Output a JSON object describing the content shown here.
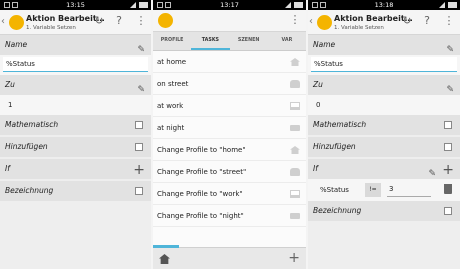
{
  "left": {
    "status_time": "13:15",
    "title": "Aktion Bearbeit…",
    "subtitle": "1. Variable Setzen",
    "name_label": "Name",
    "name_value": "%Status",
    "zu_label": "Zu",
    "zu_value": "1",
    "math_label": "Mathematisch",
    "add_label": "Hinzufügen",
    "if_label": "If",
    "bez_label": "Bezeichnung"
  },
  "middle": {
    "status_time": "13:17",
    "tabs": [
      "PROFILE",
      "TASKS",
      "SZENEN",
      "VAR"
    ],
    "tasks": [
      {
        "label": "at home",
        "icon": "house-icon"
      },
      {
        "label": "on street",
        "icon": "car-icon"
      },
      {
        "label": "at work",
        "icon": "computer-icon"
      },
      {
        "label": "at night",
        "icon": "bed-icon"
      },
      {
        "label": "Change Profile to \"home\"",
        "icon": "house-icon"
      },
      {
        "label": "Change Profile to \"street\"",
        "icon": "car-icon"
      },
      {
        "label": "Change Profile to \"work\"",
        "icon": "computer-icon"
      },
      {
        "label": "Change Profile to \"night\"",
        "icon": "bed-icon"
      }
    ]
  },
  "right": {
    "status_time": "13:18",
    "title": "Aktion Bearbeit…",
    "subtitle": "1. Variable Setzen",
    "name_label": "Name",
    "name_value": "%Status",
    "zu_label": "Zu",
    "zu_value": "0",
    "math_label": "Mathematisch",
    "add_label": "Hinzufügen",
    "if_label": "If",
    "cond_var": "%Status",
    "cond_op": "!=",
    "cond_val": "3",
    "bez_label": "Bezeichnung"
  },
  "icons": {
    "back": "‹",
    "undo": "↻",
    "help": "?",
    "menu": "⋮",
    "pencil": "✎",
    "plus": "+"
  }
}
